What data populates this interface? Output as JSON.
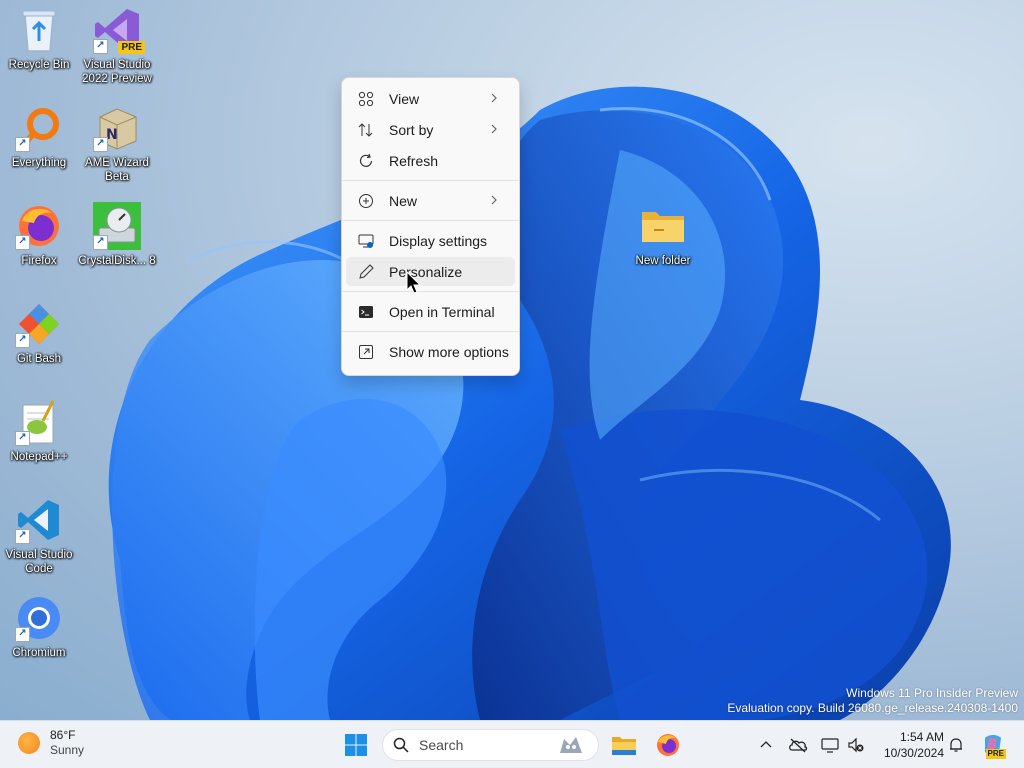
{
  "desktop": {
    "icons": [
      {
        "label": "Recycle Bin",
        "icon": "recycle-bin-icon"
      },
      {
        "label": "Visual Studio 2022 Preview",
        "icon": "visual-studio-icon",
        "badge": "PRE"
      },
      {
        "label": "Everything",
        "icon": "everything-search-icon"
      },
      {
        "label": "AME Wizard Beta",
        "icon": "ame-wizard-icon"
      },
      {
        "label": "Firefox",
        "icon": "firefox-icon"
      },
      {
        "label": "CrystalDisk... 8",
        "icon": "crystaldisk-icon"
      },
      {
        "label": "Git Bash",
        "icon": "git-bash-icon"
      },
      {
        "label": "Notepad++",
        "icon": "notepad-plus-plus-icon"
      },
      {
        "label": "Visual Studio Code",
        "icon": "vscode-icon"
      },
      {
        "label": "Chromium",
        "icon": "chromium-icon"
      },
      {
        "label": "New folder",
        "icon": "folder-icon"
      }
    ]
  },
  "context_menu": {
    "items": [
      {
        "label": "View",
        "icon": "grid-view-icon",
        "submenu": true
      },
      {
        "label": "Sort by",
        "icon": "sort-icon",
        "submenu": true
      },
      {
        "label": "Refresh",
        "icon": "refresh-icon",
        "submenu": false
      },
      {
        "label": "New",
        "icon": "plus-circle-icon",
        "submenu": true
      },
      {
        "label": "Display settings",
        "icon": "display-settings-icon",
        "submenu": false
      },
      {
        "label": "Personalize",
        "icon": "pen-icon",
        "submenu": false,
        "hovered": true
      },
      {
        "label": "Open in Terminal",
        "icon": "terminal-icon",
        "submenu": false
      },
      {
        "label": "Show more options",
        "icon": "share-options-icon",
        "submenu": false
      }
    ]
  },
  "watermark": {
    "line1": "Windows 11 Pro Insider Preview",
    "line2": "Evaluation copy. Build 26080.ge_release.240308-1400"
  },
  "taskbar": {
    "weather": {
      "temp": "86°F",
      "condition": "Sunny"
    },
    "search": {
      "placeholder": "Search"
    },
    "pinned": [
      "windows-start-icon",
      "file-explorer-icon",
      "firefox-icon"
    ],
    "tray_icons": [
      "chevron-up-icon",
      "onedrive-offline-icon",
      "network-icon",
      "volume-muted-icon",
      "notification-bell-icon",
      "copilot-icon"
    ],
    "clock": {
      "time": "1:54 AM",
      "date": "10/30/2024"
    },
    "copilot_badge": "PRE"
  },
  "colors": {
    "accent": "#0067c0",
    "wallpaper_blue": "#1565e6",
    "taskbar_bg": "#eef2f6",
    "menu_bg": "#f9f9f9"
  }
}
